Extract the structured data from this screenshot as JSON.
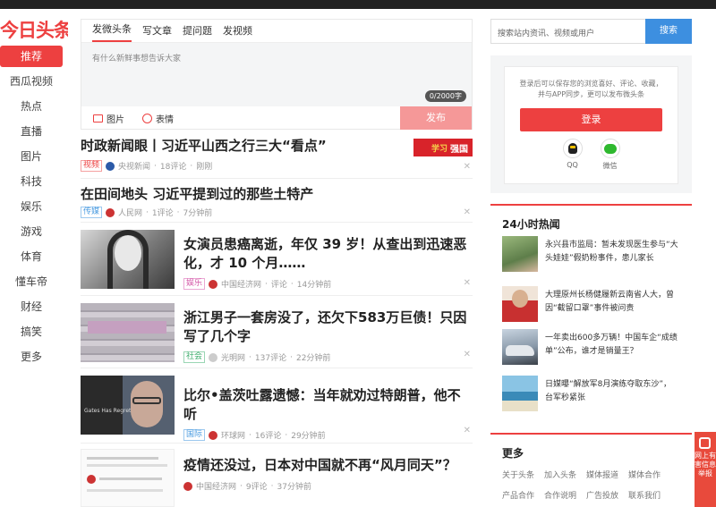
{
  "logo": "今日头条",
  "nav": [
    "推荐",
    "西瓜视频",
    "热点",
    "直播",
    "图片",
    "科技",
    "娱乐",
    "游戏",
    "体育",
    "懂车帝",
    "财经",
    "搞笑",
    "更多"
  ],
  "composer": {
    "tabs": [
      "发微头条",
      "写文章",
      "提问题",
      "发视频"
    ],
    "placeholder": "有什么新鲜事想告诉大家",
    "counter": "0/2000字",
    "tool_image": "图片",
    "tool_emoji": "表情",
    "publish": "发布"
  },
  "feed": [
    {
      "title": "时政新闻眼丨习近平山西之行三大“看点”",
      "tag": "视频",
      "source": "央视新闻",
      "comments": "18评论",
      "time": "刚刚",
      "badge": "强国",
      "badge_logo": "学习"
    },
    {
      "title": "在田间地头 习近平提到过的那些土特产",
      "tag": "传媒",
      "source": "人民网",
      "comments": "1评论",
      "time": "7分钟前"
    },
    {
      "title": "女演员患癌离逝，年仅 39 岁！从查出到迅速恶化，才 10 个月……",
      "tag": "娱乐",
      "source": "中国经济网",
      "comments": "评论",
      "time": "14分钟前"
    },
    {
      "title": "浙江男子一套房没了，还欠下583万巨债！只因写了几个字",
      "tag": "社会",
      "source": "光明网",
      "comments": "137评论",
      "time": "22分钟前"
    },
    {
      "title": "比尔•盖茨吐露遗憾：当年就劝过特朗普，他不听",
      "tag": "国际",
      "source": "环球网",
      "comments": "16评论",
      "time": "29分钟前",
      "thumb_caption": "Gates Has Regrets"
    },
    {
      "title": "疫情还没过，日本对中国就不再“风月同天”？",
      "source": "中国经济网",
      "comments": "9评论",
      "time": "37分钟前"
    }
  ],
  "feed_separator": "·",
  "close_glyph": "✕",
  "search": {
    "placeholder": "搜索站内资讯、视频或用户",
    "button": "搜索"
  },
  "login": {
    "text": "登录后可以保存您的浏览喜好、评论、收藏，并与APP同步，更可以发布微头条",
    "button": "登录",
    "qq": "QQ",
    "wechat": "微信"
  },
  "hot": {
    "title": "24小时热闻",
    "items": [
      "永兴县市监局：暂未发现医生参与“大头娃娃”假奶粉事件，患儿家长",
      "大理原州长杨健履新云南省人大，曾因“截留口罩”事件被问责",
      "一年卖出600多万辆！中国车企“成绩单”公布，谁才是销量王？",
      "日媒曝“解放军8月演练夺取东沙”，台军秒紧张"
    ]
  },
  "more": {
    "title": "更多",
    "links": [
      "关于头条",
      "加入头条",
      "媒体报道",
      "媒体合作",
      "产品合作",
      "合作说明",
      "广告投放",
      "联系我们"
    ]
  },
  "float_label": "网上有害信息举报",
  "colors": {
    "accent": "#ed4040",
    "search_button": "#3d8fe0",
    "publish_disabled": "#f59898"
  }
}
